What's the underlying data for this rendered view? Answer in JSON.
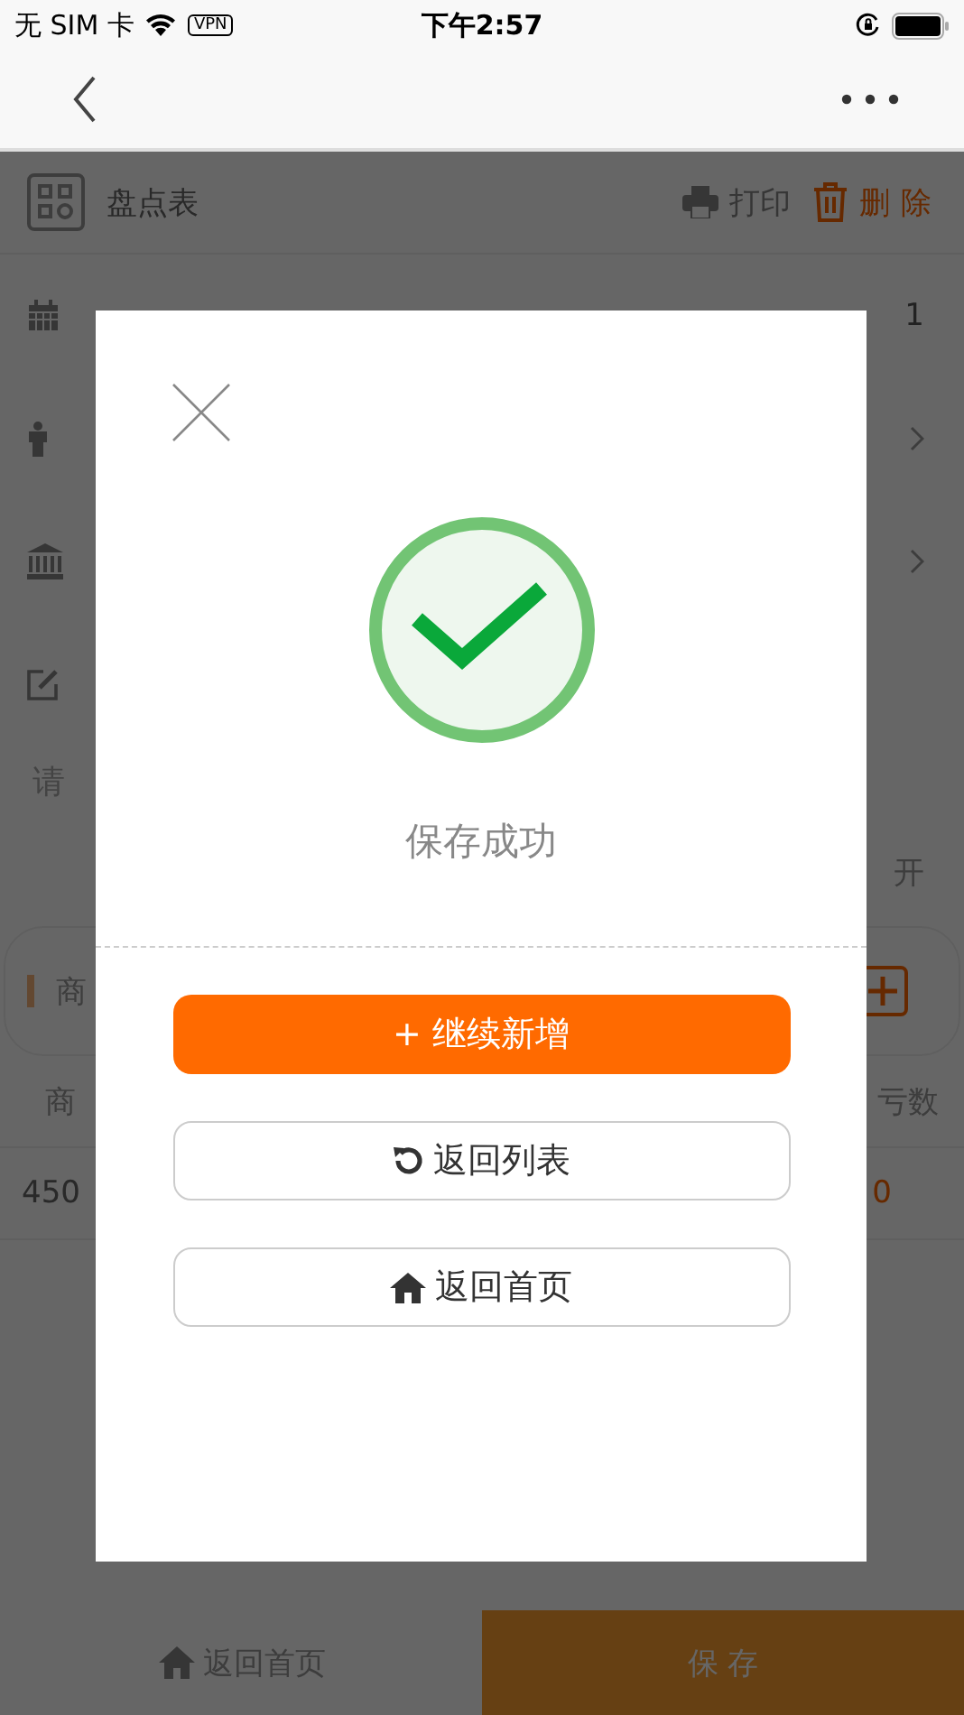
{
  "status_bar": {
    "carrier": "无 SIM 卡",
    "vpn": "VPN",
    "time": "下午2:57"
  },
  "background": {
    "title": "盘点表",
    "actions": [
      {
        "kind": "print",
        "label": "打印"
      },
      {
        "kind": "delete",
        "label": "删除"
      }
    ],
    "rows": [
      {
        "kind": "date",
        "value": "1"
      },
      {
        "kind": "person"
      },
      {
        "kind": "bank"
      },
      {
        "kind": "note"
      }
    ],
    "note_placeholder": "请",
    "expand": "开",
    "search": {
      "placeholder": "商"
    },
    "table": {
      "columns": [
        "商",
        "亏数"
      ],
      "rows": [
        [
          "450",
          "0"
        ]
      ]
    },
    "bottom_bar": {
      "home": "返回首页",
      "save": "保 存"
    }
  },
  "dialog": {
    "message": "保存成功",
    "buttons": [
      {
        "kind": "primary",
        "label": "+ 继续新增"
      },
      {
        "kind": "list",
        "label": "返回列表"
      },
      {
        "kind": "home",
        "label": "返回首页"
      }
    ]
  }
}
